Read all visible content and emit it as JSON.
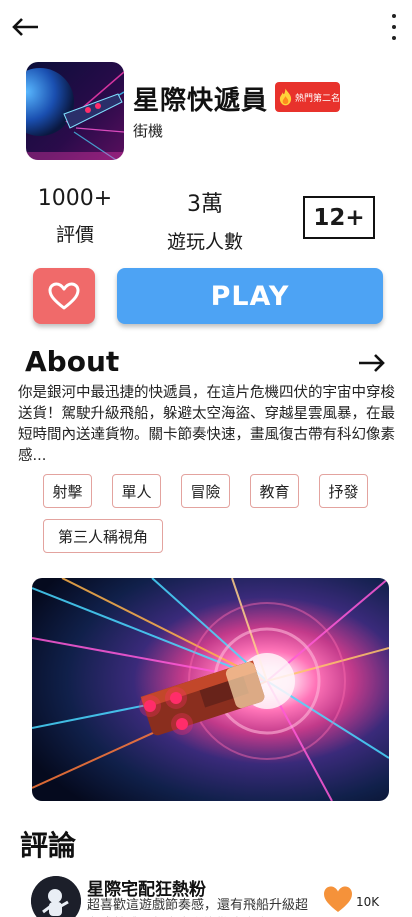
{
  "app": {
    "title": "星際快遞員",
    "hot_badge": "熱門第二名",
    "category": "街機"
  },
  "stats": {
    "reviews_count": "1000+",
    "reviews_label": "評價",
    "players_count": "3萬",
    "players_label": "遊玩人數",
    "age_rating": "12+"
  },
  "actions": {
    "play_label": "PLAY"
  },
  "about": {
    "heading": "About",
    "description": "你是銀河中最迅捷的快遞員，在這片危機四伏的宇宙中穿梭送貨！駕駛升級飛船，躲避太空海盜、穿越星雲風暴，在最短時間內送達貨物。關卡節奏快速，畫風復古帶有科幻像素感..."
  },
  "tags": [
    "射擊",
    "單人",
    "冒險",
    "教育",
    "抒發",
    "第三人稱視角"
  ],
  "reviews": {
    "heading": "評論",
    "items": [
      {
        "name": "星際宅配狂熱粉",
        "text": "超喜歡這遊戲節奏感，還有飛船升級超有成就感，但太空海盜難度太高了！",
        "likes": "10K"
      }
    ]
  },
  "colors": {
    "favorite_button": "#f06a6a",
    "play_button": "#4da3f4",
    "hot_badge": "#e8322c",
    "tag_border": "#e3a39f",
    "like_heart": "#f5923a"
  },
  "icons": {
    "back": "arrow-left-icon",
    "more": "more-vertical-icon",
    "favorite": "heart-outline-icon",
    "about_arrow": "arrow-right-icon",
    "hot": "flame-icon",
    "like": "heart-filled-icon"
  }
}
